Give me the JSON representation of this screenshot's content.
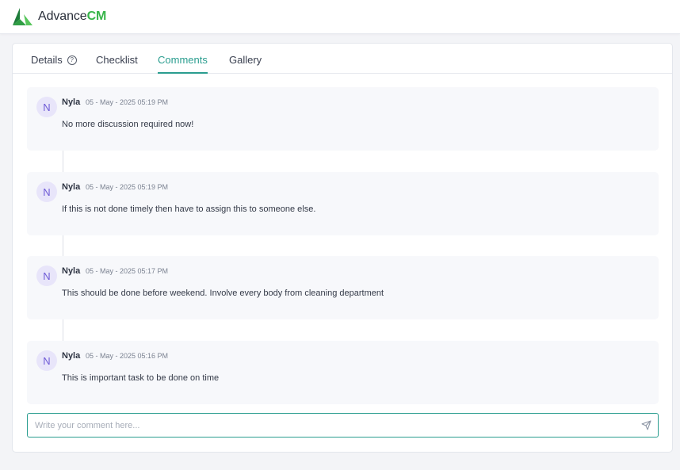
{
  "app": {
    "logo_text_main": "Advance",
    "logo_text_accent": "CM",
    "logo_icon": "triangle-logo-icon",
    "brand_colors": {
      "dark_green": "#1e7d3a",
      "light_green": "#38b54a",
      "accent_teal": "#2a9d8f"
    }
  },
  "tabs": [
    {
      "label": "Details",
      "icon": "help-circle-icon",
      "active": false
    },
    {
      "label": "Checklist",
      "active": false
    },
    {
      "label": "Comments",
      "active": true
    },
    {
      "label": "Gallery",
      "active": false
    }
  ],
  "comments": [
    {
      "avatar_initial": "N",
      "author": "Nyla",
      "timestamp": "05 - May - 2025 05:19 PM",
      "text": "No more discussion required now!"
    },
    {
      "avatar_initial": "N",
      "author": "Nyla",
      "timestamp": "05 - May - 2025 05:19 PM",
      "text": "If this is not done timely then have to assign this to someone else."
    },
    {
      "avatar_initial": "N",
      "author": "Nyla",
      "timestamp": "05 - May - 2025 05:17 PM",
      "text": "This should be done before weekend. Involve every body from cleaning department"
    },
    {
      "avatar_initial": "N",
      "author": "Nyla",
      "timestamp": "05 - May - 2025 05:16 PM",
      "text": "This is important task to be done on time"
    }
  ],
  "comment_input": {
    "value": "",
    "placeholder": "Write your comment here...",
    "send_icon": "send-icon"
  }
}
